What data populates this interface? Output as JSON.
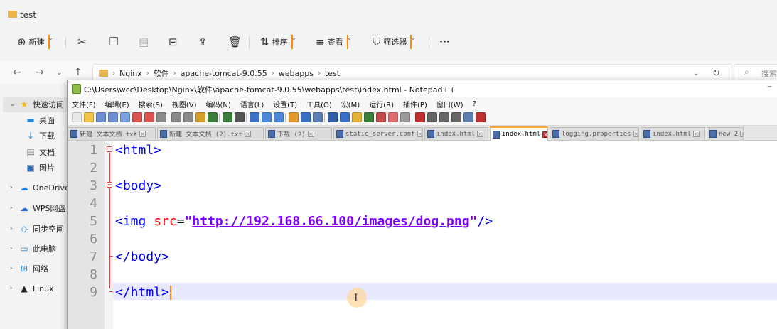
{
  "explorer": {
    "title": "test",
    "toolbar": {
      "new_label": "新建",
      "sort_label": "排序",
      "view_label": "查看",
      "filter_label": "筛选器",
      "more_label": "···"
    },
    "breadcrumb": [
      "Nginx",
      "软件",
      "apache-tomcat-9.0.55",
      "webapps",
      "test"
    ],
    "search_placeholder": "搜索",
    "sidebar": [
      {
        "label": "快速访问",
        "icon": "star-icon"
      },
      {
        "label": "桌面",
        "icon": "desktop-icon"
      },
      {
        "label": "下载",
        "icon": "download-icon"
      },
      {
        "label": "文档",
        "icon": "document-icon"
      },
      {
        "label": "图片",
        "icon": "picture-icon"
      },
      {
        "label": "OneDrive",
        "icon": "cloud-icon"
      },
      {
        "label": "WPS网盘",
        "icon": "cloud-icon"
      },
      {
        "label": "同步空间",
        "icon": "sync-icon"
      },
      {
        "label": "此电脑",
        "icon": "computer-icon"
      },
      {
        "label": "网络",
        "icon": "network-icon"
      },
      {
        "label": "Linux",
        "icon": "linux-icon"
      }
    ]
  },
  "notepad": {
    "title": "C:\\Users\\wcc\\Desktop\\Nginx\\软件\\apache-tomcat-9.0.55\\webapps\\test\\index.html - Notepad++",
    "minimize": "–",
    "menu": [
      "文件(F)",
      "编辑(E)",
      "搜索(S)",
      "视图(V)",
      "编码(N)",
      "语言(L)",
      "设置(T)",
      "工具(O)",
      "宏(M)",
      "运行(R)",
      "插件(P)",
      "窗口(W)",
      "?"
    ],
    "tabs": [
      {
        "label": "新建 文本文档.txt",
        "active": false
      },
      {
        "label": "新建 文本文档 (2).txt",
        "active": false
      },
      {
        "label": "下载 (2)",
        "active": false
      },
      {
        "label": "static_server.conf",
        "active": false
      },
      {
        "label": "index.html",
        "active": false
      },
      {
        "label": "index.html",
        "active": true
      },
      {
        "label": "logging.properties",
        "active": false
      },
      {
        "label": "index.html",
        "active": false
      },
      {
        "label": "new 2",
        "active": false
      }
    ],
    "line_numbers": [
      "1",
      "2",
      "3",
      "4",
      "5",
      "6",
      "7",
      "8",
      "9"
    ],
    "code": {
      "l1": "<html>",
      "l3": "<body>",
      "l5_tag_open": "<img",
      "l5_attr": "src",
      "l5_eq": "=",
      "l5_quote_open": "\"",
      "l5_value": "http://192.168.66.100/images/dog.png",
      "l5_quote_close": "\"",
      "l5_tag_close": "/>",
      "l7": "</body>",
      "l9": "</html>"
    },
    "current_line": 9
  },
  "colors": {
    "tag": "#0000ff",
    "attribute": "#ff0000",
    "string": "#8000ff",
    "active_tab_accent": "#f5a93a",
    "current_line_bg": "#e8e8ff"
  }
}
